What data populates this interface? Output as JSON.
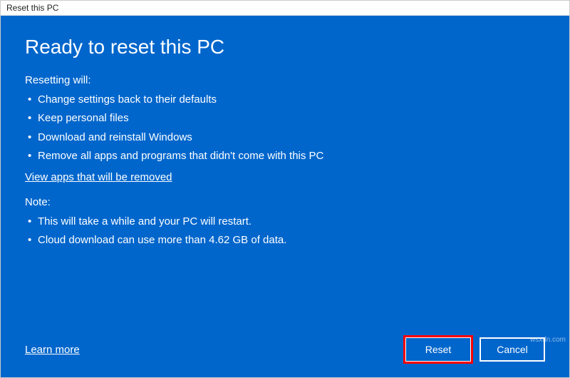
{
  "window": {
    "title": "Reset this PC"
  },
  "heading": "Ready to reset this PC",
  "resetting": {
    "label": "Resetting will:",
    "items": [
      "Change settings back to their defaults",
      "Keep personal files",
      "Download and reinstall Windows",
      "Remove all apps and programs that didn't come with this PC"
    ]
  },
  "view_apps_link": "View apps that will be removed",
  "note": {
    "label": "Note:",
    "items": [
      "This will take a while and your PC will restart.",
      "Cloud download can use more than 4.62 GB of data."
    ]
  },
  "learn_more": "Learn more",
  "buttons": {
    "reset": "Reset",
    "cancel": "Cancel"
  },
  "watermark": "wsxdn.com"
}
